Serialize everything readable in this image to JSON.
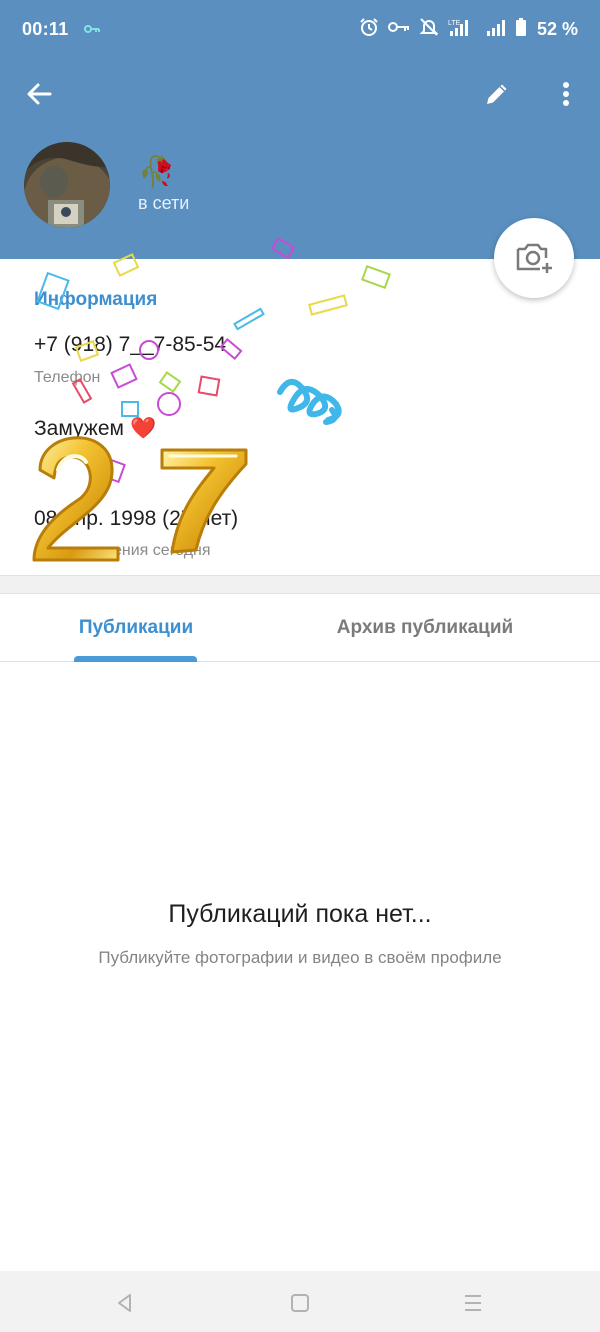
{
  "status_bar": {
    "time": "00:11",
    "battery": "52 %",
    "icons": [
      "vpn-key-icon",
      "alarm-icon",
      "key-icon",
      "bell-off-icon",
      "lte-signal-icon",
      "signal-icon",
      "battery-icon"
    ]
  },
  "toolbar": {
    "back_icon": "arrow-left-icon",
    "edit_icon": "pencil-icon",
    "menu_icon": "more-vertical-icon"
  },
  "profile": {
    "name": "🥀",
    "status": "в сети"
  },
  "info": {
    "title": "Информация",
    "phone": "+7 (918) 7__7-85-54",
    "phone_label": "Телефон",
    "bio": "Замужем",
    "bio_emoji": "❤️",
    "birthday": "08 апр. 1998 (27 лет)",
    "birthday_label": "День рождения сегодня",
    "decoration_text": "27"
  },
  "tabs": [
    {
      "label": "Публикации",
      "active": true
    },
    {
      "label": "Архив публикаций",
      "active": false
    }
  ],
  "empty_state": {
    "title": "Публикаций пока нет...",
    "subtitle": "Публикуйте фотографии и видео в своём профиле"
  },
  "nav_bar": {
    "icons": [
      "nav-back-icon",
      "nav-home-icon",
      "nav-recents-icon"
    ]
  },
  "colors": {
    "header": "#5a8fbf",
    "accent": "#3e8fcf",
    "balloon_gold": "#f2c230"
  }
}
